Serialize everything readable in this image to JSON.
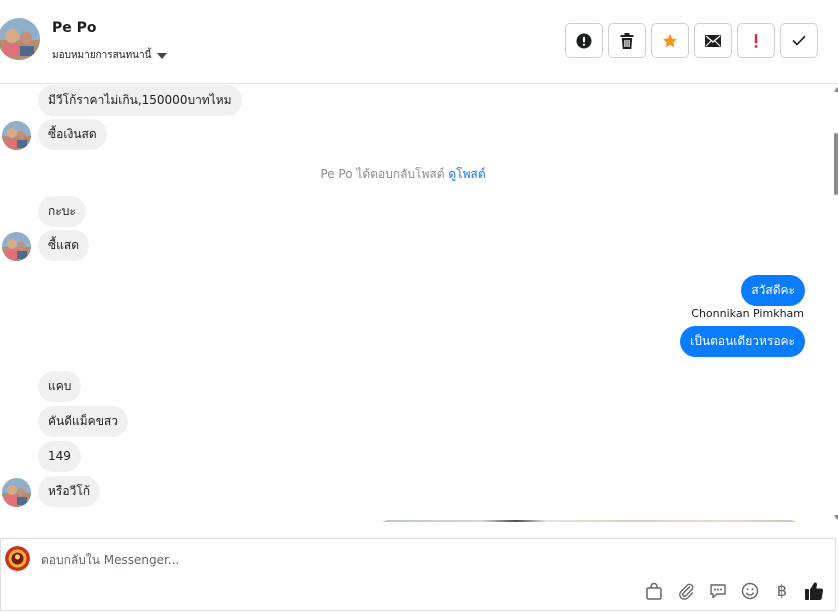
{
  "header": {
    "contact_name": "Pe Po",
    "assign_label": "มอบหมายการสนทนานี้",
    "toolbar": [
      {
        "name": "report-button",
        "icon": "exclamation-circle-icon"
      },
      {
        "name": "delete-button",
        "icon": "trash-icon"
      },
      {
        "name": "star-button",
        "icon": "star-icon",
        "color": "#f7931e"
      },
      {
        "name": "mark-unread-button",
        "icon": "envelope-icon"
      },
      {
        "name": "mark-important-button",
        "icon": "exclamation-icon",
        "color": "#e41e3f"
      },
      {
        "name": "done-button",
        "icon": "checkmark-icon"
      }
    ]
  },
  "messages": {
    "m1": "มีวีโก้ราคาไม่เกิน,150000บาทไหม",
    "m2": "ซื้อเงินสด",
    "system_note": "Pe Po ได้ตอบกลับโพสต์",
    "system_link": "ดูโพสต์",
    "m3": "กะบะ",
    "m4": "ซื้แสด",
    "out1": "สวัสดีคะ",
    "sender_label": "Chonnikan Pimkham",
    "out2": "เป็นตอนเดียวหรอคะ",
    "m5": "แคบ",
    "m6": "คันดีแม็คขสว",
    "m7": "149",
    "m8": "หรือวีโก้"
  },
  "composer": {
    "placeholder": "ตอบกลับใน Messenger...",
    "tools": [
      "bag-icon",
      "paperclip-icon",
      "saved-reply-icon",
      "emoji-icon",
      "baht-icon",
      "thumbs-up-icon"
    ],
    "baht_symbol": "฿"
  },
  "colors": {
    "outgoing_bubble": "#0a7cff",
    "incoming_bubble": "#f0f0f0",
    "link": "#1877f2"
  }
}
